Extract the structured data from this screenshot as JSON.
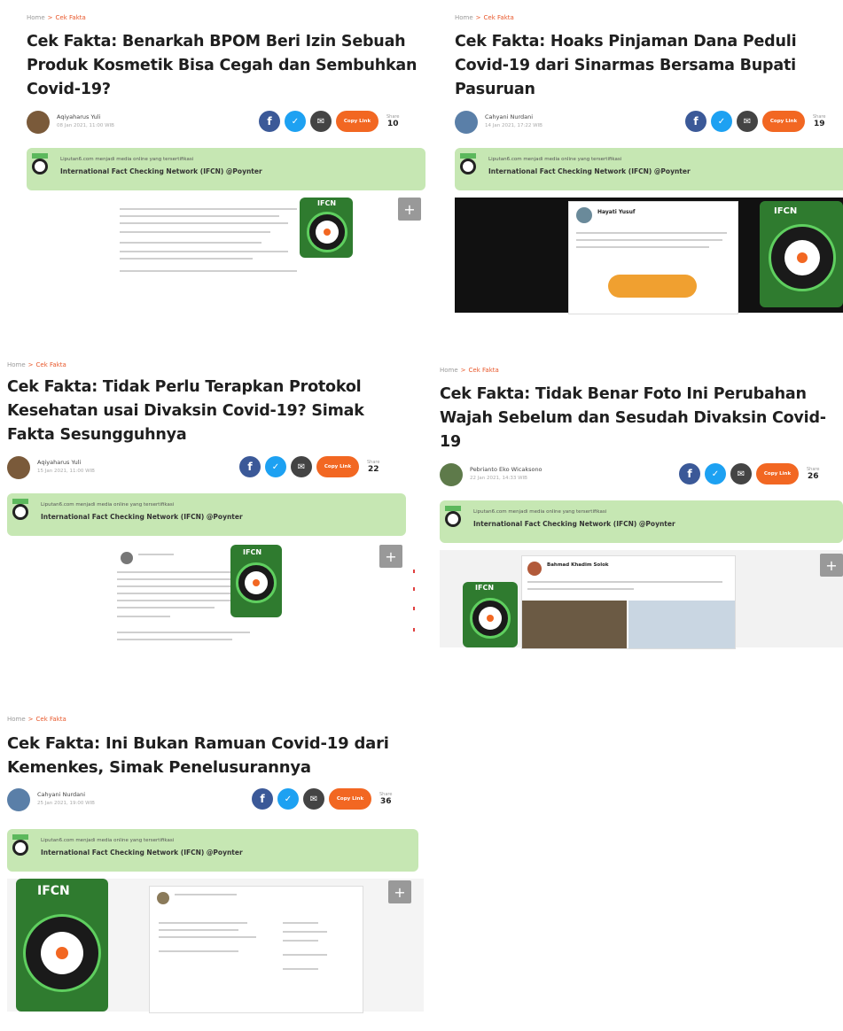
{
  "cards": [
    {
      "breadcrumb_home": "Home",
      "breadcrumb_cat": "Cek Fakta",
      "title": "Cek Fakta: Benarkah BPOM Beri Izin Sebuah Produk Kosmetik Bisa Cegah dan Sembuhkan Covid-19?",
      "author": "Aqiyaharus Yuli",
      "date": "08 Jan 2021, 11:00 WIB",
      "share_label": "Share",
      "share_count": "10",
      "copy_label": "Copy Link"
    },
    {
      "breadcrumb_home": "Home",
      "breadcrumb_cat": "Cek Fakta",
      "title": "Cek Fakta: Hoaks Pinjaman Dana Peduli Covid-19 dari Sinarmas Bersama Bupati Pasuruan",
      "author": "Cahyani Nurdani",
      "date": "14 Jan 2021, 17:22 WIB",
      "share_label": "Share",
      "share_count": "19",
      "copy_label": "Copy Link"
    },
    {
      "breadcrumb_home": "Home",
      "breadcrumb_cat": "Cek Fakta",
      "title": "Cek Fakta: Tidak Perlu Terapkan Protokol Kesehatan usai Divaksin Covid-19? Simak Fakta Sesungguhnya",
      "author": "Aqiyaharus Yuli",
      "date": "15 Jan 2021, 11:00 WIB",
      "share_label": "Share",
      "share_count": "22",
      "copy_label": "Copy Link"
    },
    {
      "breadcrumb_home": "Home",
      "breadcrumb_cat": "Cek Fakta",
      "title": "Cek Fakta: Tidak Benar Foto Ini Perubahan Wajah Sebelum dan Sesudah Divaksin Covid-19",
      "author": "Pebrianto Eko Wicaksono",
      "date": "22 Jan 2021, 14:33 WIB",
      "share_label": "Share",
      "share_count": "26",
      "copy_label": "Copy Link"
    },
    {
      "breadcrumb_home": "Home",
      "breadcrumb_cat": "Cek Fakta",
      "title": "Cek Fakta: Ini Bukan Ramuan Covid-19 dari Kemenkes, Simak Penelusurannya",
      "author": "Cahyani Nurdani",
      "date": "25 Jan 2021, 19:00 WIB",
      "share_label": "Share",
      "share_count": "36",
      "copy_label": "Copy Link"
    }
  ],
  "ifcn_line1": "Liputan6.com menjadi media online yang tersertifikasi",
  "ifcn_line2": "International Fact Checking Network (IFCN) @Poynter",
  "ifcn_logo_text": "IFCN",
  "tweet_author": "Hayati Yusuf",
  "fb_author": "Bahmad Khadim Solok",
  "colors": {
    "accent": "#f26722",
    "facebook": "#3b5998",
    "twitter": "#1da1f2",
    "ifcn_banner": "#c6e7b3"
  }
}
